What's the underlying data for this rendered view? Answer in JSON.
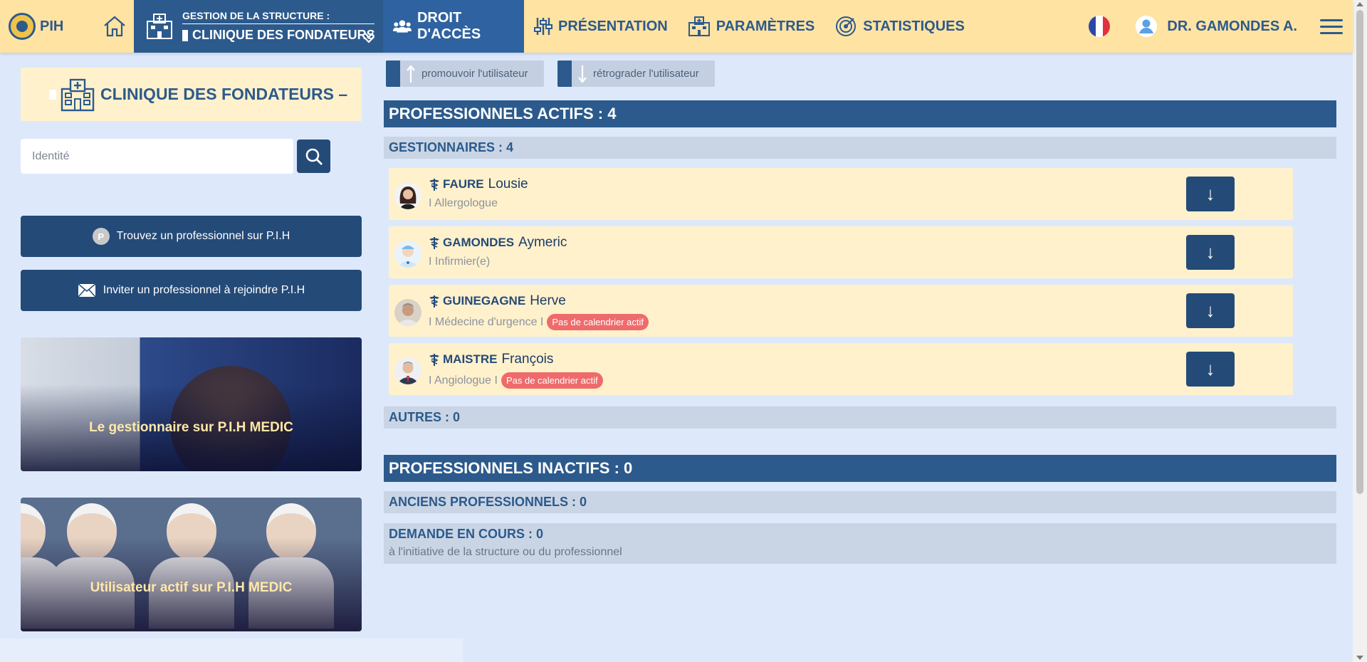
{
  "header": {
    "logo_text": "PIH",
    "structure_label": "GESTION DE LA STRUCTURE :",
    "structure_value": "CLINIQUE DES FONDATEURS",
    "tabs": [
      {
        "label": "DROIT D'ACCÈS",
        "active": true
      },
      {
        "label": "PRÉSENTATION"
      },
      {
        "label": "PARAMÈTRES"
      },
      {
        "label": "STATISTIQUES"
      }
    ],
    "user_name": "DR. GAMONDES A."
  },
  "sidebar": {
    "clinic_title": "CLINIQUE DES FONDATEURS –",
    "search_placeholder": "Identité",
    "find_button": "Trouvez un professionnel sur P.I.H",
    "find_icon_letter": "P",
    "invite_button": "Inviter un professionnel à rejoindre P.I.H",
    "card1_text": "Le gestionnaire sur P.I.H MEDIC",
    "card2_text": "Utilisateur actif sur P.I.H MEDIC"
  },
  "toolbar": {
    "promote": "promouvoir l'utilisateur",
    "demote": "rétrograder l'utilisateur"
  },
  "sections": {
    "active_title": "PROFESSIONNELS ACTIFS : 4",
    "managers_title": "GESTIONNAIRES : 4",
    "others_title": "AUTRES : 0",
    "inactive_title": "PROFESSIONNELS INACTIFS : 0",
    "former_title": "ANCIENS PROFESSIONNELS : 0",
    "requests_title": "DEMANDE EN COURS : 0",
    "requests_sub": "à l'initiative de la structure ou du professionnel"
  },
  "professionals": [
    {
      "last": "FAURE",
      "first": "Lousie",
      "specialty": "I Allergologue",
      "badge": "",
      "avatar": "woman-avatar"
    },
    {
      "last": "GAMONDES",
      "first": "Aymeric",
      "specialty": "I Infirmier(e)",
      "badge": "",
      "avatar": "nurse-avatar"
    },
    {
      "last": "GUINEGAGNE",
      "first": "Herve",
      "specialty": "I Médecine d'urgence I",
      "badge": "Pas de calendrier actif",
      "avatar": "man-avatar"
    },
    {
      "last": "MAISTRE",
      "first": "François",
      "specialty": "I Angiologue I",
      "badge": "Pas de calendrier actif",
      "avatar": "man-suit-avatar"
    }
  ],
  "demote_arrow": "↓",
  "colors": {
    "primary": "#2c5a8c",
    "header_bg": "#ffe3a3",
    "row_bg": "#fff1cc",
    "badge": "#ef6b6b",
    "page_bg": "#dde9fb"
  }
}
